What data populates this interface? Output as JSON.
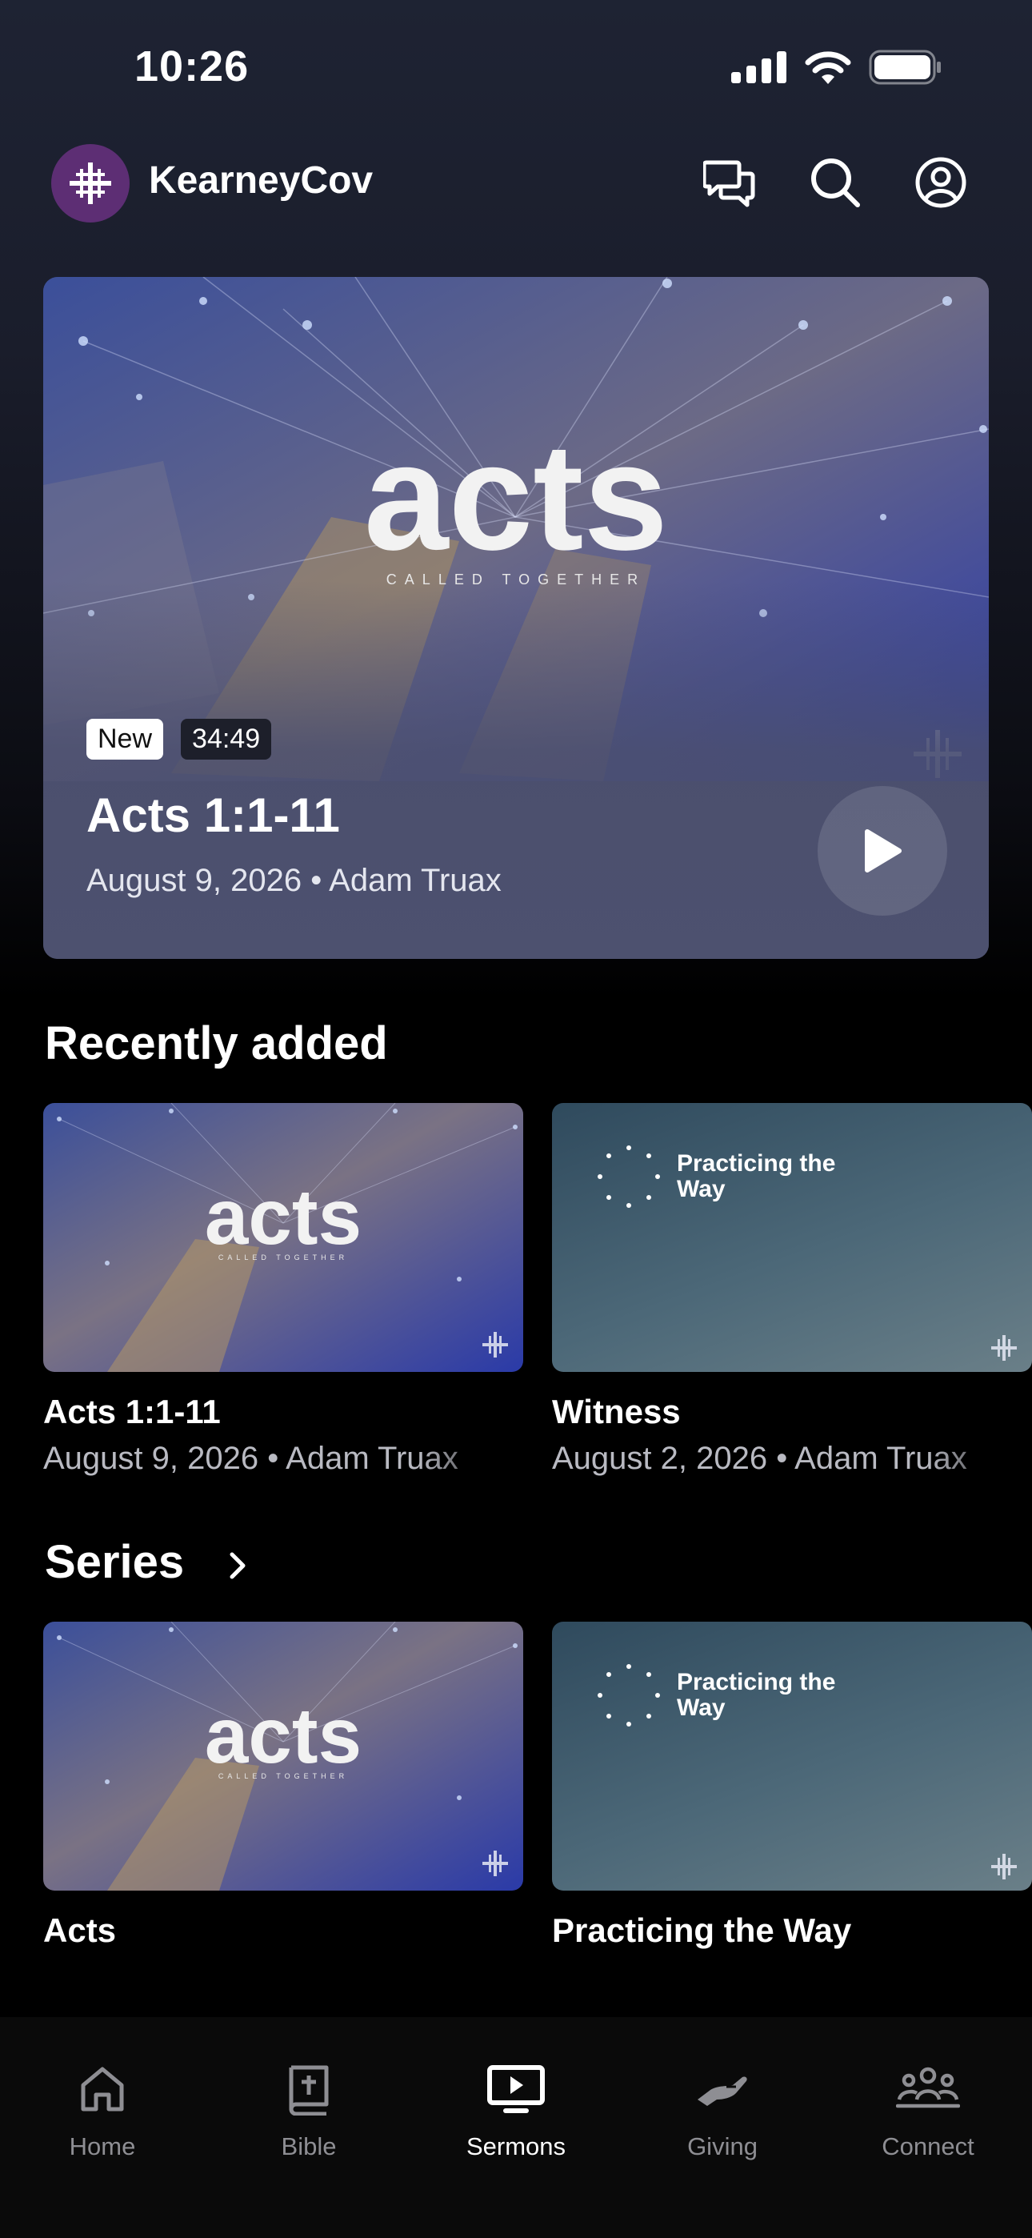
{
  "status_bar": {
    "time": "10:26"
  },
  "header": {
    "app_title": "KearneyCov"
  },
  "hero": {
    "art_title": "acts",
    "art_subtitle": "CALLED TOGETHER",
    "badge_new": "New",
    "duration": "34:49",
    "title": "Acts 1:1-11",
    "date": "August 9, 2026",
    "speaker": "Adam Truax"
  },
  "recent": {
    "title": "Recently added",
    "items": [
      {
        "art": "acts",
        "art_sub": "CALLED TOGETHER",
        "title": "Acts 1:1-11",
        "date": "August 9, 2026",
        "speaker": "Adam Truax"
      },
      {
        "art": "Practicing the Way",
        "title": "Witness",
        "date": "August 2, 2026",
        "speaker": "Adam Truax"
      }
    ]
  },
  "series": {
    "title": "Series",
    "items": [
      {
        "art": "acts",
        "art_sub": "CALLED TOGETHER",
        "title": "Acts"
      },
      {
        "art": "Practicing the Way",
        "title": "Practicing the Way"
      }
    ]
  },
  "tabs": [
    {
      "label": "Home",
      "icon": "home-icon",
      "active": false
    },
    {
      "label": "Bible",
      "icon": "bible-icon",
      "active": false
    },
    {
      "label": "Sermons",
      "icon": "sermons-icon",
      "active": true
    },
    {
      "label": "Giving",
      "icon": "giving-icon",
      "active": false
    },
    {
      "label": "Connect",
      "icon": "connect-icon",
      "active": false
    }
  ],
  "colors": {
    "logo_bg": "#5d2e74",
    "hero_card_bg": "#4b4f6e",
    "tab_inactive": "#8e8e93",
    "art_blue": "#2b3a9c"
  }
}
